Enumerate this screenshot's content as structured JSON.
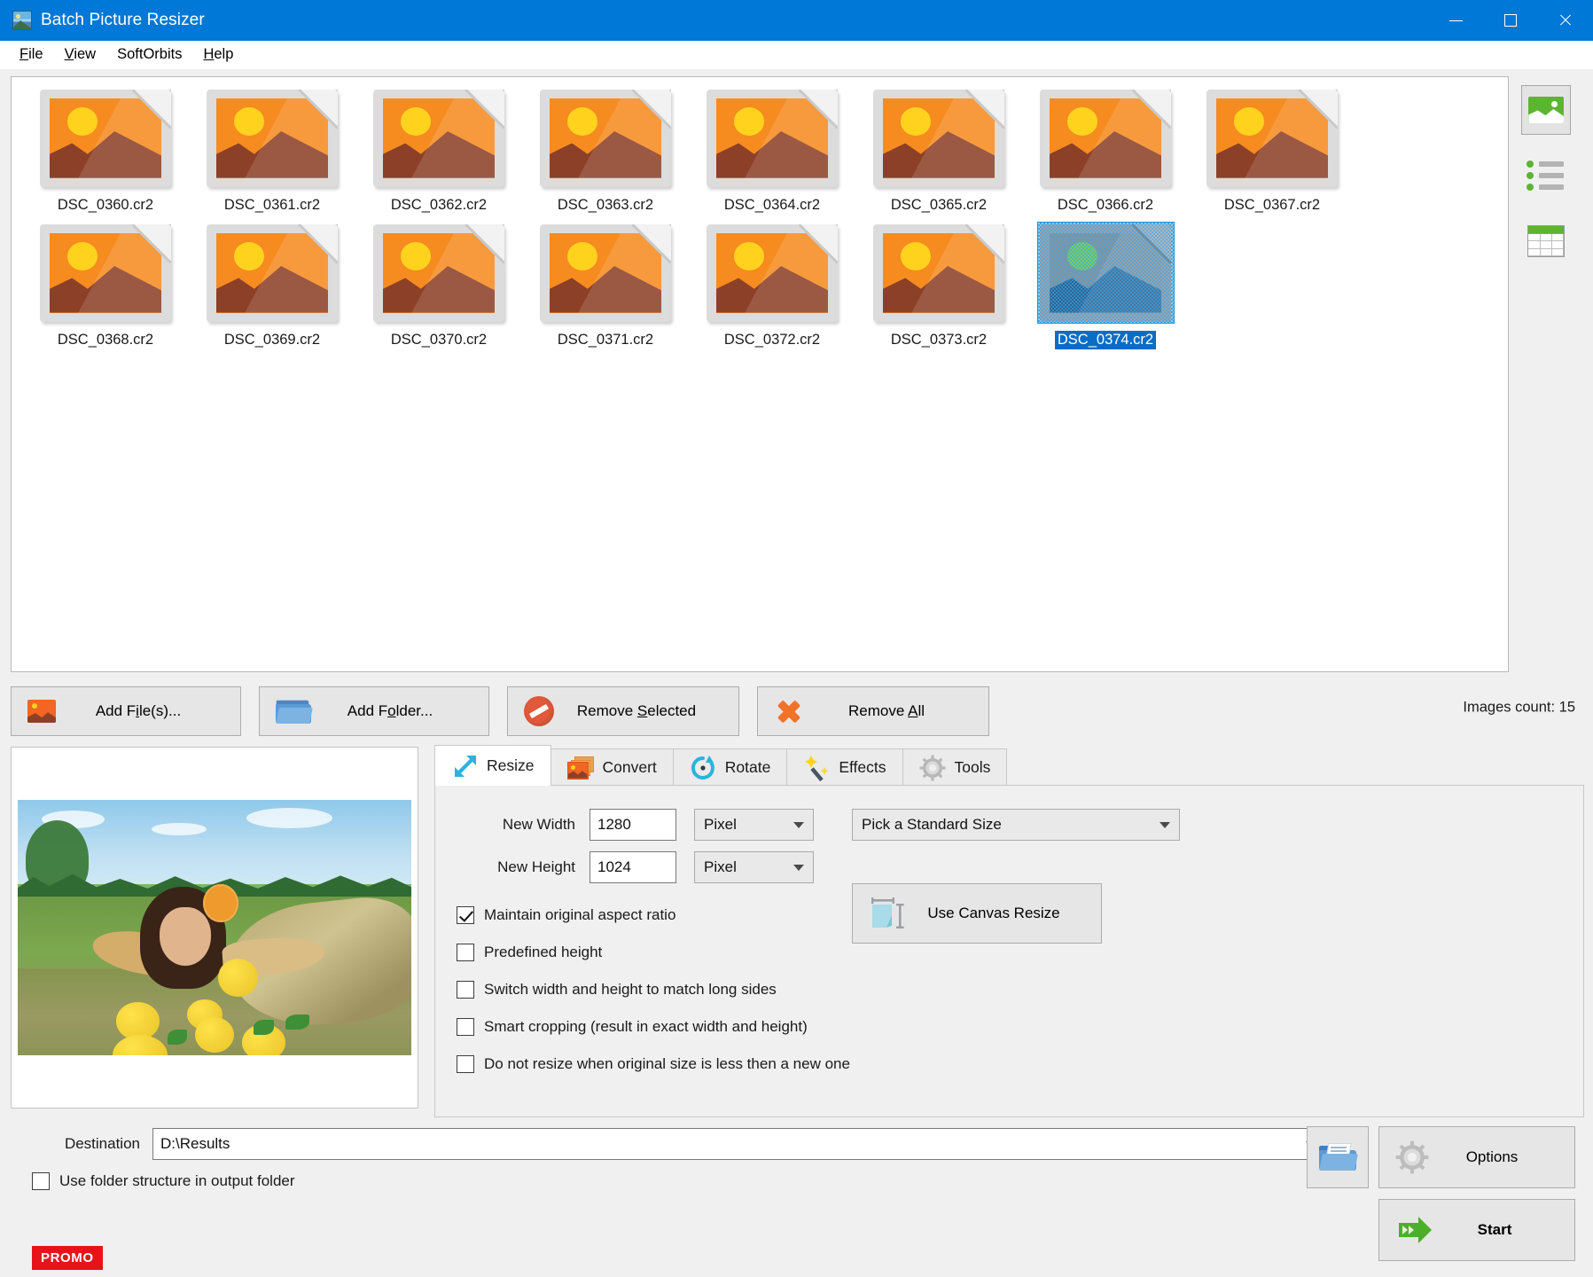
{
  "window": {
    "title": "Batch Picture Resizer",
    "icon": "app-logo-icon",
    "minimize": "minimize-icon",
    "maximize": "maximize-icon",
    "close": "close-icon"
  },
  "menu": [
    {
      "label": "File",
      "accel": "F"
    },
    {
      "label": "View",
      "accel": "V"
    },
    {
      "label": "SoftOrbits",
      "accel": ""
    },
    {
      "label": "Help",
      "accel": "H"
    }
  ],
  "thumbnails": [
    {
      "name": "DSC_0360.cr2",
      "selected": false
    },
    {
      "name": "DSC_0361.cr2",
      "selected": false
    },
    {
      "name": "DSC_0362.cr2",
      "selected": false
    },
    {
      "name": "DSC_0363.cr2",
      "selected": false
    },
    {
      "name": "DSC_0364.cr2",
      "selected": false
    },
    {
      "name": "DSC_0365.cr2",
      "selected": false
    },
    {
      "name": "DSC_0366.cr2",
      "selected": false
    },
    {
      "name": "DSC_0367.cr2",
      "selected": false
    },
    {
      "name": "DSC_0368.cr2",
      "selected": false
    },
    {
      "name": "DSC_0369.cr2",
      "selected": false
    },
    {
      "name": "DSC_0370.cr2",
      "selected": false
    },
    {
      "name": "DSC_0371.cr2",
      "selected": false
    },
    {
      "name": "DSC_0372.cr2",
      "selected": false
    },
    {
      "name": "DSC_0373.cr2",
      "selected": false
    },
    {
      "name": "DSC_0374.cr2",
      "selected": true
    }
  ],
  "view_modes": [
    {
      "name": "thumbnail-view",
      "icon": "thumbnail-view-icon",
      "active": true
    },
    {
      "name": "list-view",
      "icon": "list-view-icon",
      "active": false
    },
    {
      "name": "details-view",
      "icon": "details-grid-view-icon",
      "active": false
    }
  ],
  "actions": {
    "add_files": {
      "label_pre": "Add F",
      "label_accel": "i",
      "label_post": "le(s)...",
      "icon": "add-picture-icon"
    },
    "add_folder": {
      "label_pre": "Add F",
      "label_accel": "o",
      "label_post": "lder...",
      "icon": "folder-icon"
    },
    "remove_selected": {
      "label_pre": "Remove ",
      "label_accel": "S",
      "label_post": "elected",
      "icon": "no-entry-icon"
    },
    "remove_all": {
      "label_pre": "Remove ",
      "label_accel": "A",
      "label_post": "ll",
      "icon": "x-mark-icon"
    },
    "images_count": "Images count: 15"
  },
  "tabs": [
    {
      "label": "Resize",
      "icon": "resize-arrows-icon",
      "active": true
    },
    {
      "label": "Convert",
      "icon": "convert-images-icon",
      "active": false
    },
    {
      "label": "Rotate",
      "icon": "rotate-circle-icon",
      "active": false
    },
    {
      "label": "Effects",
      "icon": "magic-wand-icon",
      "active": false
    },
    {
      "label": "Tools",
      "icon": "gear-icon",
      "active": false
    }
  ],
  "resize_panel": {
    "new_width_label": "New Width",
    "new_width_value": "1280",
    "new_width_unit": "Pixel",
    "new_height_label": "New Height",
    "new_height_value": "1024",
    "new_height_unit": "Pixel",
    "standard_size": "Pick a Standard Size",
    "canvas_resize_label": "Use Canvas Resize",
    "checkboxes": [
      {
        "label": "Maintain original aspect ratio",
        "checked": true
      },
      {
        "label": "Predefined height",
        "checked": false
      },
      {
        "label": "Switch width and height to match long sides",
        "checked": false
      },
      {
        "label": "Smart cropping (result in exact width and height)",
        "checked": false
      },
      {
        "label": "Do not resize when original size is less then a new one",
        "checked": false
      }
    ]
  },
  "preview": {
    "alt": "preview of woman lying in grass with yellow apples"
  },
  "bottom": {
    "destination_label": "Destination",
    "destination_value": "D:\\Results",
    "use_folder_structure_label": "Use folder structure in output folder",
    "use_folder_structure_checked": false,
    "browse_icon": "browse-folder-icon",
    "options_label": "Options",
    "options_icon": "gear-icon",
    "start_label": "Start",
    "start_icon": "green-arrow-icon",
    "promo_label": "PROMO"
  },
  "colors": {
    "titlebar": "#0078d7",
    "accent_green": "#5cb531",
    "accent_orange": "#f26522",
    "promo_red": "#e8131a",
    "selection_blue": "#0a6dc4"
  }
}
